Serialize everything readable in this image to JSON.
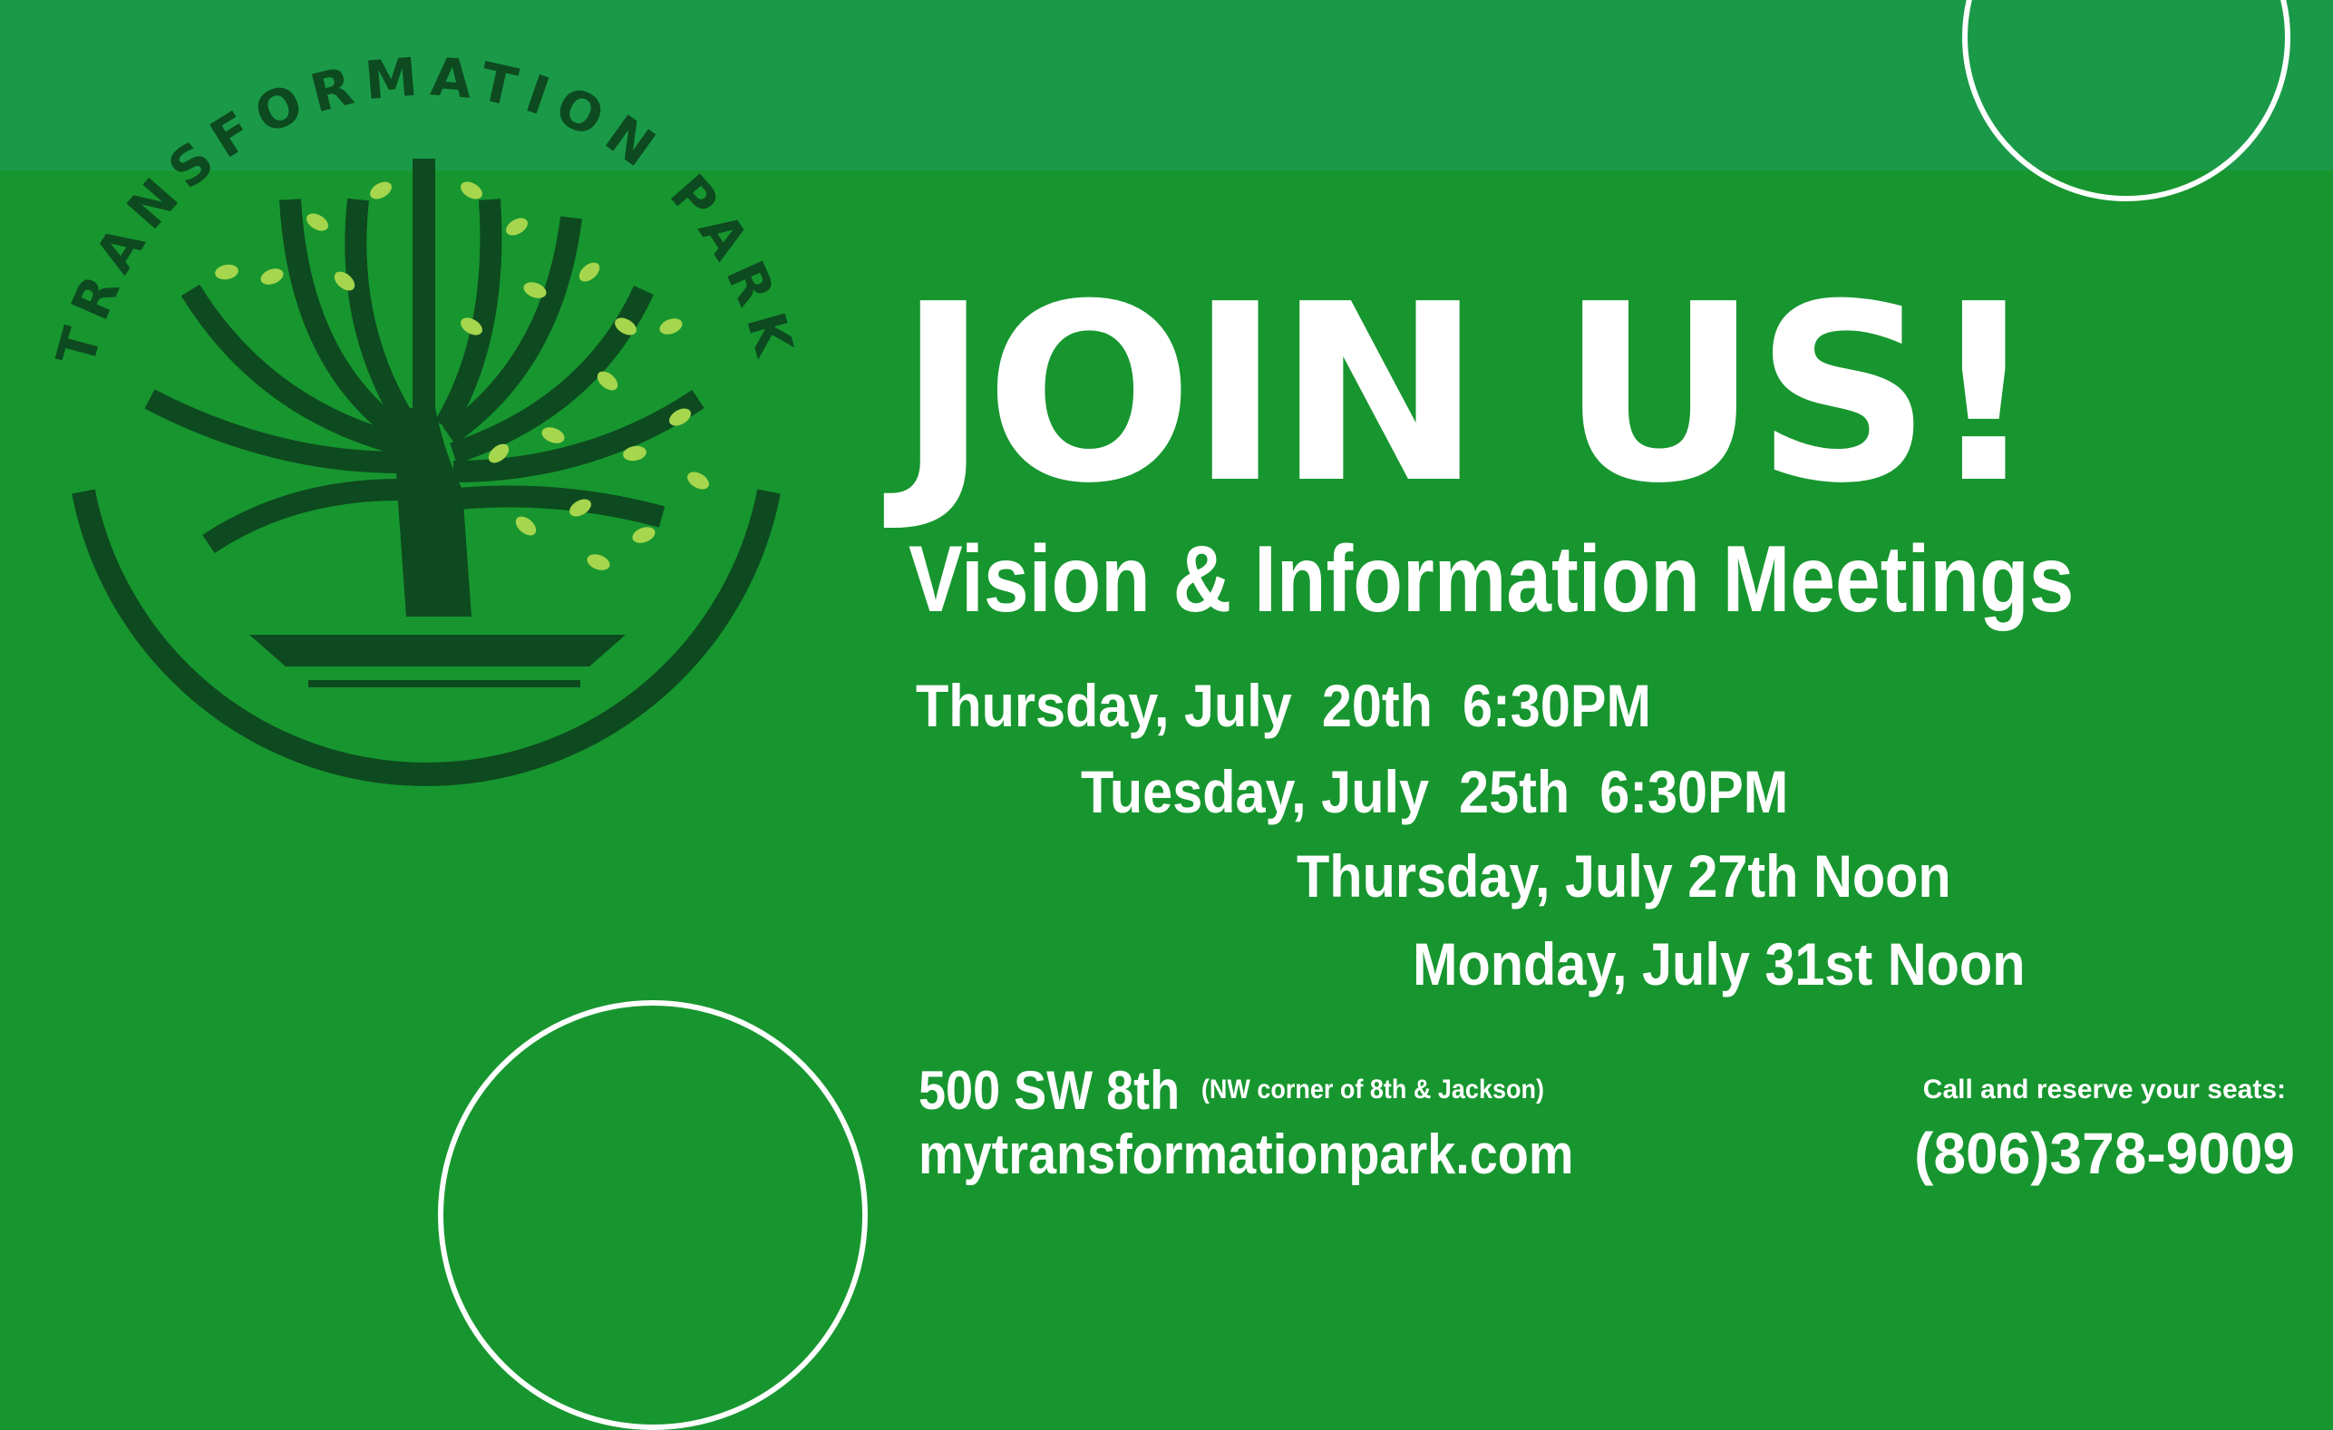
{
  "colors": {
    "background": "#17962f",
    "top_band": "#1a9a48",
    "logo_dark": "#0d4a1f",
    "leaf_light": "#a6d64e",
    "text": "#ffffff"
  },
  "logo": {
    "text": "TRANSFORMATION PARK",
    "icon": "tree-icon"
  },
  "headline": "JOIN US!",
  "subheadline": "Vision & Information Meetings",
  "meetings": [
    "Thursday, July  20th  6:30PM",
    "Tuesday, July  25th  6:30PM",
    "Thursday, July 27th Noon",
    "Monday, July 31st Noon"
  ],
  "location": {
    "address": "500 SW 8th",
    "note": "(NW corner of 8th & Jackson)",
    "website": "mytransformationpark.com"
  },
  "contact": {
    "prompt": "Call and reserve your seats:",
    "phone": "(806)378-9009"
  }
}
